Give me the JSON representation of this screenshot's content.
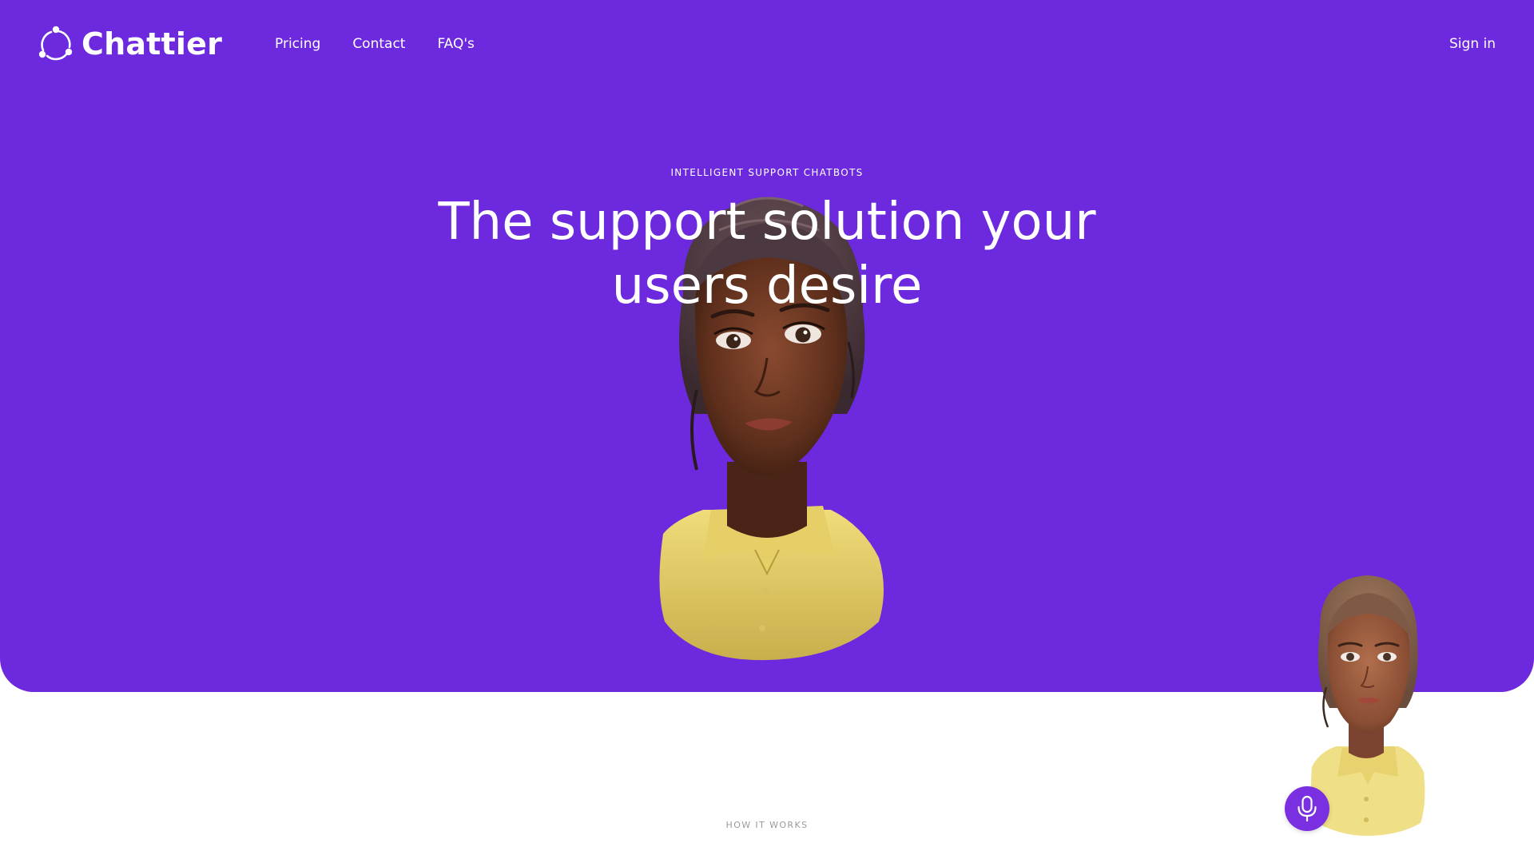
{
  "brand": {
    "name": "Chattier",
    "logo_icon": "circle-dots-logo-icon",
    "accent_color": "#6c29dd"
  },
  "nav": {
    "items": [
      {
        "label": "Pricing"
      },
      {
        "label": "Contact"
      },
      {
        "label": "FAQ's"
      }
    ],
    "signin_label": "Sign in"
  },
  "hero": {
    "eyebrow": "INTELLIGENT SUPPORT CHATBOTS",
    "headline_line1": "The support solution your",
    "headline_line2": "users desire",
    "image": "3d-avatar-woman-yellow-shirt"
  },
  "section": {
    "eyebrow": "HOW IT WORKS"
  },
  "widget": {
    "image": "3d-avatar-woman-thumbnail",
    "button_icon": "microphone-icon"
  }
}
